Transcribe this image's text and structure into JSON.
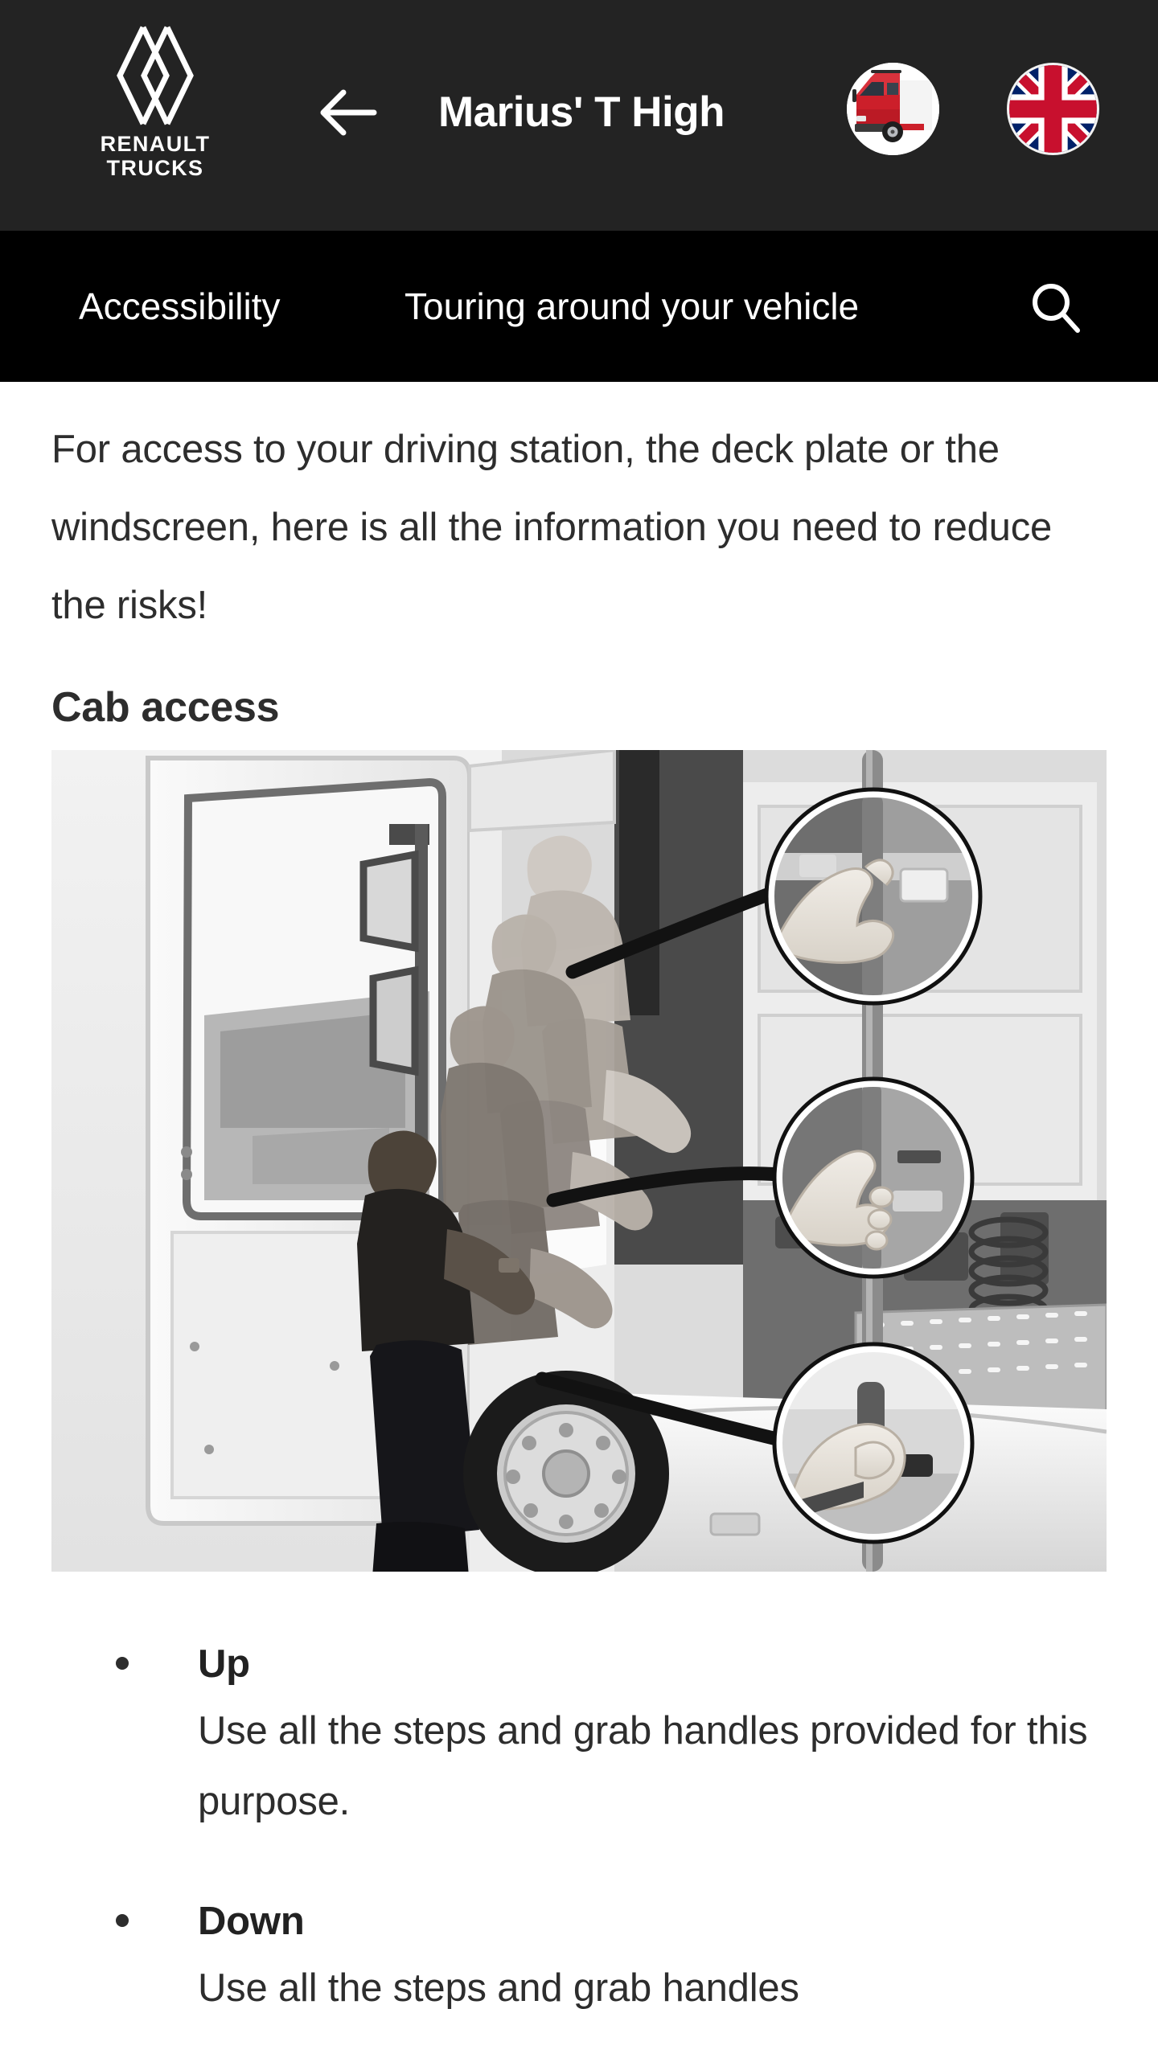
{
  "header": {
    "brand_wordmark": "RENAULT\nTRUCKS",
    "brand_logo_icon": "renault-diamond-logo",
    "back_icon": "arrow-left-icon",
    "title": "Marius' T High",
    "vehicle_avatar_icon": "truck-avatar-icon",
    "language_flag_icon": "uk-flag-icon",
    "background_color": "#232323",
    "text_color": "#ffffff"
  },
  "nav": {
    "background_color": "#000000",
    "items": [
      {
        "label": "Accessibility"
      },
      {
        "label": "Touring around your vehicle"
      }
    ],
    "search_icon": "search-icon"
  },
  "main": {
    "intro_paragraph": "For access to your driving station, the deck plate or the windscreen, here is all the information you need to reduce the risks!",
    "section_heading": "Cab access",
    "figure": {
      "alt": "Grayscale photo of drivers climbing into a truck cab with three circular close-up callouts of hands gripping the grab handles",
      "callout_count": 3
    },
    "bullets": [
      {
        "term": "Up",
        "description": "Use all the steps and grab handles provided for this purpose."
      },
      {
        "term": "Down",
        "description": "Use all the steps and grab handles"
      }
    ]
  },
  "colors": {
    "page_background": "#ffffff",
    "body_text": "#2d2d2d",
    "header_background": "#232323",
    "nav_background": "#000000",
    "brand_red": "#cc1f2a",
    "flag_blue": "#012169",
    "flag_red": "#c8102e"
  }
}
